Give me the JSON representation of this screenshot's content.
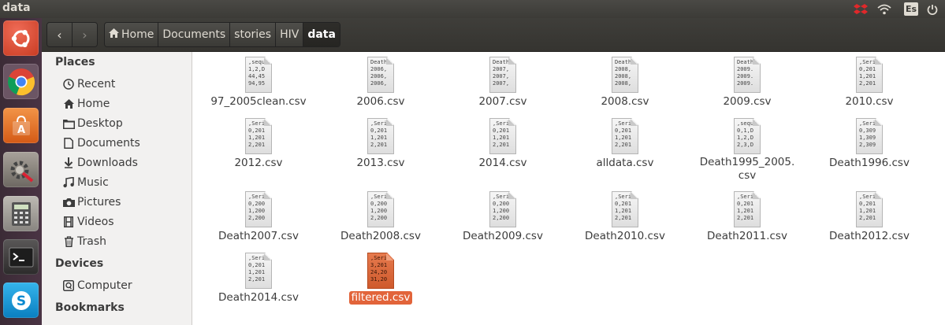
{
  "window": {
    "title": "data"
  },
  "panel": {
    "keyboard_layout": "Es"
  },
  "toolbar": {
    "back_label": "‹",
    "forward_label": "›",
    "breadcrumbs": [
      "Home",
      "Documents",
      "stories",
      "HIV",
      "data"
    ]
  },
  "sidebar": {
    "places_title": "Places",
    "places": [
      "Recent",
      "Home",
      "Desktop",
      "Documents",
      "Downloads",
      "Music",
      "Pictures",
      "Videos",
      "Trash"
    ],
    "devices_title": "Devices",
    "devices": [
      "Computer"
    ],
    "bookmarks_title": "Bookmarks"
  },
  "files": [
    {
      "name": "97_2005clean.csv",
      "preview": ",sequ\n1,2,D\n44,45\n94,95"
    },
    {
      "name": "2006.csv",
      "preview": "Death\n2006,\n2006,\n2006,"
    },
    {
      "name": "2007.csv",
      "preview": "Death\n2007,\n2007,\n2007,"
    },
    {
      "name": "2008.csv",
      "preview": "Death\n2008,\n2008,\n2008,"
    },
    {
      "name": "2009.csv",
      "preview": "Death\n2009.\n2009.\n2009."
    },
    {
      "name": "2010.csv",
      "preview": ",Seri\n0,201\n1,201\n2,201"
    },
    {
      "name": "2012.csv",
      "preview": ",Seri\n0,201\n1,201\n2,201"
    },
    {
      "name": "2013.csv",
      "preview": ",Seri\n0,201\n1,201\n2,201"
    },
    {
      "name": "2014.csv",
      "preview": ",Seri\n0,201\n1,201\n2,201"
    },
    {
      "name": "alldata.csv",
      "preview": ",Seri\n0,201\n1,201\n2,201"
    },
    {
      "name": "Death1995_2005.csv",
      "preview": ",sequ\n0,1,D\n1,2,D\n2,3,D"
    },
    {
      "name": "Death1996.csv",
      "preview": ",Seri\n0,309\n1,309\n2,309"
    },
    {
      "name": "Death2007.csv",
      "preview": ",Seri\n0,200\n1,200\n2,200"
    },
    {
      "name": "Death2008.csv",
      "preview": ",Seri\n0,200\n1,200\n2,200"
    },
    {
      "name": "Death2009.csv",
      "preview": ",Seri\n0,200\n1,200\n2,200"
    },
    {
      "name": "Death2010.csv",
      "preview": ",Seri\n0,201\n1,201\n2,201"
    },
    {
      "name": "Death2011.csv",
      "preview": ",Seri\n0,201\n1,201\n2,201"
    },
    {
      "name": "Death2012.csv",
      "preview": ",Seri\n0,201\n1,201\n2,201"
    },
    {
      "name": "Death2014.csv",
      "preview": ",Seri\n0,201\n1,201\n2,201"
    },
    {
      "name": "filtered.csv",
      "preview": ",Seri\n3,201\n24,20\n31,20",
      "selected": true
    }
  ],
  "colors": {
    "selection": "#e2643a",
    "panel": "#3c3b37",
    "launcher": "#4a3444"
  }
}
